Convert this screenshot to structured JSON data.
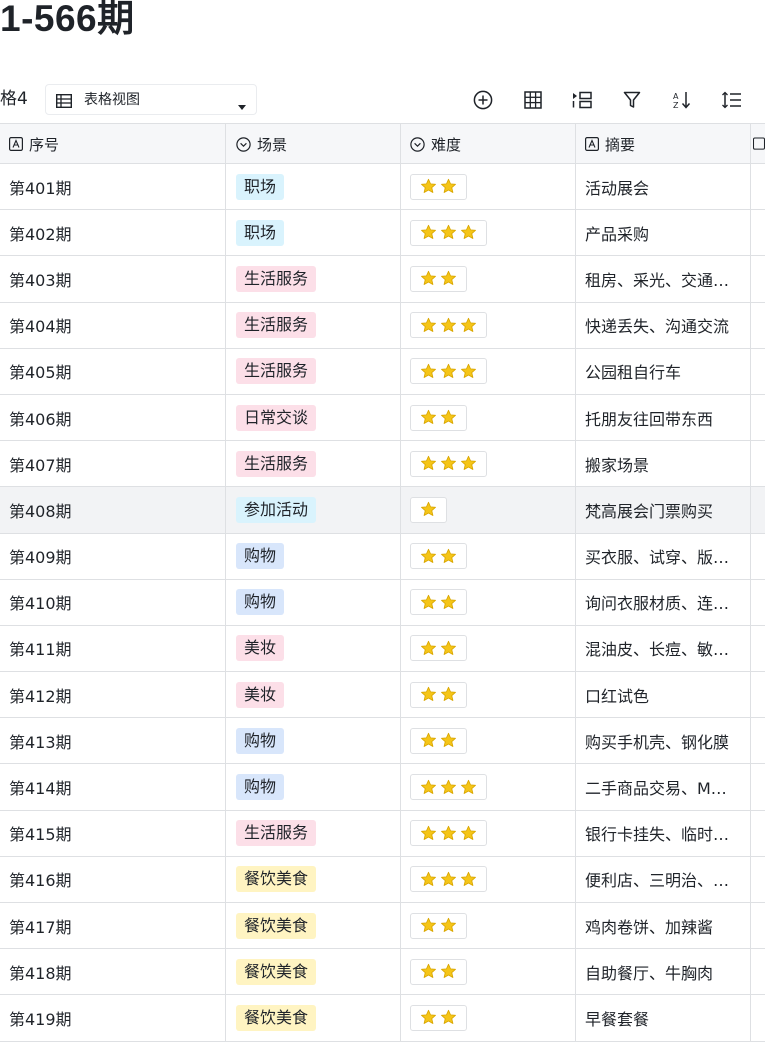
{
  "page": {
    "title": "1-566期"
  },
  "toolbar": {
    "view_name": "格4",
    "view_select_label": "表格视图",
    "tools": [
      {
        "icon": "add-record-icon"
      },
      {
        "icon": "grid-layout-icon"
      },
      {
        "icon": "group-icon"
      },
      {
        "icon": "filter-icon"
      },
      {
        "icon": "sort-icon"
      },
      {
        "icon": "row-height-icon"
      }
    ]
  },
  "table": {
    "columns": [
      {
        "label": "序号",
        "icon": "text-field-icon"
      },
      {
        "label": "场景",
        "icon": "single-select-icon"
      },
      {
        "label": "难度",
        "icon": "single-select-icon"
      },
      {
        "label": "摘要",
        "icon": "text-field-icon"
      }
    ],
    "rows": [
      {
        "no": "第401期",
        "scene": "职场",
        "tag_color": "#d9f3fd",
        "stars": 2,
        "summary": "活动展会"
      },
      {
        "no": "第402期",
        "scene": "职场",
        "tag_color": "#d9f3fd",
        "stars": 3,
        "summary": "产品采购"
      },
      {
        "no": "第403期",
        "scene": "生活服务",
        "tag_color": "#fcdfe8",
        "stars": 2,
        "summary": "租房、采光、交通…"
      },
      {
        "no": "第404期",
        "scene": "生活服务",
        "tag_color": "#fcdfe8",
        "stars": 3,
        "summary": "快递丢失、沟通交流"
      },
      {
        "no": "第405期",
        "scene": "生活服务",
        "tag_color": "#fcdfe8",
        "stars": 3,
        "summary": "公园租自行车"
      },
      {
        "no": "第406期",
        "scene": "日常交谈",
        "tag_color": "#fcdfe8",
        "stars": 2,
        "summary": "托朋友往回带东西"
      },
      {
        "no": "第407期",
        "scene": "生活服务",
        "tag_color": "#fcdfe8",
        "stars": 3,
        "summary": "搬家场景"
      },
      {
        "no": "第408期",
        "scene": "参加活动",
        "tag_color": "#d9f3fd",
        "stars": 1,
        "summary": "梵高展会门票购买",
        "highlighted": true
      },
      {
        "no": "第409期",
        "scene": "购物",
        "tag_color": "#d8e6fb",
        "stars": 2,
        "summary": "买衣服、试穿、版…"
      },
      {
        "no": "第410期",
        "scene": "购物",
        "tag_color": "#d8e6fb",
        "stars": 2,
        "summary": "询问衣服材质、连…"
      },
      {
        "no": "第411期",
        "scene": "美妆",
        "tag_color": "#fcdfe8",
        "stars": 2,
        "summary": "混油皮、长痘、敏…"
      },
      {
        "no": "第412期",
        "scene": "美妆",
        "tag_color": "#fcdfe8",
        "stars": 2,
        "summary": "口红试色"
      },
      {
        "no": "第413期",
        "scene": "购物",
        "tag_color": "#d8e6fb",
        "stars": 2,
        "summary": "购买手机壳、钢化膜"
      },
      {
        "no": "第414期",
        "scene": "购物",
        "tag_color": "#d8e6fb",
        "stars": 3,
        "summary": "二手商品交易、M…"
      },
      {
        "no": "第415期",
        "scene": "生活服务",
        "tag_color": "#fcdfe8",
        "stars": 3,
        "summary": "银行卡挂失、临时…"
      },
      {
        "no": "第416期",
        "scene": "餐饮美食",
        "tag_color": "#fff4c2",
        "stars": 3,
        "summary": "便利店、三明治、…"
      },
      {
        "no": "第417期",
        "scene": "餐饮美食",
        "tag_color": "#fff4c2",
        "stars": 2,
        "summary": "鸡肉卷饼、加辣酱"
      },
      {
        "no": "第418期",
        "scene": "餐饮美食",
        "tag_color": "#fff4c2",
        "stars": 2,
        "summary": "自助餐厅、牛胸肉"
      },
      {
        "no": "第419期",
        "scene": "餐饮美食",
        "tag_color": "#fff4c2",
        "stars": 2,
        "summary": "早餐套餐"
      }
    ]
  }
}
